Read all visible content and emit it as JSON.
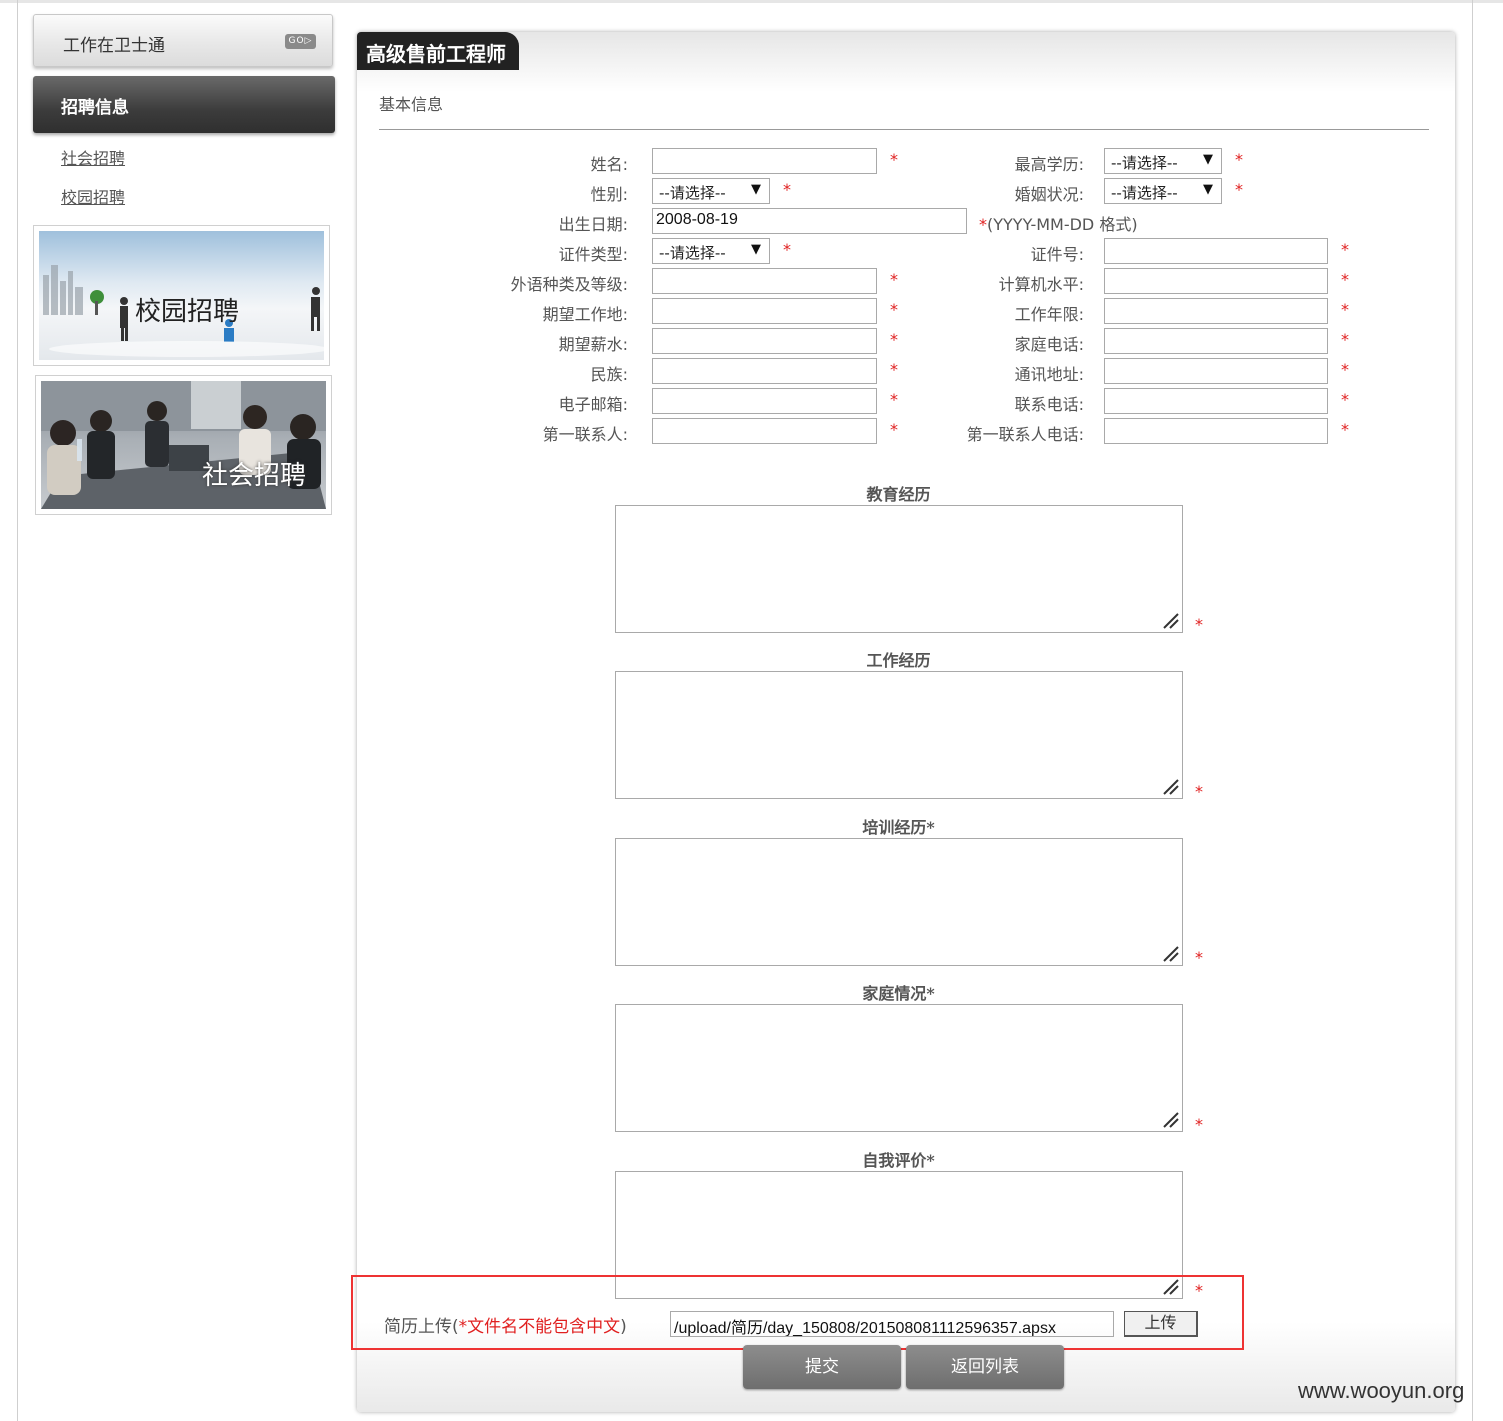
{
  "sidebar": {
    "company_box": "工作在卫士通",
    "go_badge": "GO▷",
    "section_header": "招聘信息",
    "links": [
      "社会招聘",
      "校园招聘"
    ],
    "banner_campus_text": "校园招聘",
    "banner_social_text": "社会招聘"
  },
  "job": {
    "title": "高级售前工程师",
    "section": "基本信息"
  },
  "form": {
    "required_mark": "*",
    "name_label": "姓名:",
    "gender_label": "性别:",
    "birth_label": "出生日期:",
    "birth_value": "2008-08-19",
    "birth_hint_star": "*",
    "birth_hint": "(YYYY-MM-DD 格式)",
    "idtype_label": "证件类型:",
    "lang_label": "外语种类及等级:",
    "workplace_label": "期望工作地:",
    "salary_label": "期望薪水:",
    "ethnic_label": "民族:",
    "email_label": "电子邮箱:",
    "contact_label": "第一联系人:",
    "edu_label": "最高学历:",
    "marital_label": "婚姻状况:",
    "idno_label": "证件号:",
    "computer_label": "计算机水平:",
    "years_label": "工作年限:",
    "homephone_label": "家庭电话:",
    "address_label": "通讯地址:",
    "phone_label": "联系电话:",
    "contact_phone_label": "第一联系人电话:",
    "select_placeholder": "--请选择--",
    "select_arrow": "▼"
  },
  "textareas": {
    "education": "教育经历",
    "work": "工作经历",
    "training": "培训经历*",
    "family": "家庭情况*",
    "self_eval": "自我评价*"
  },
  "upload": {
    "label_prefix": "简历上传(",
    "label_red": "*文件名不能包含中文",
    "label_suffix": ")",
    "path_value": "/upload/简历/day_150808/201508081112596357.apsx",
    "button": "上传"
  },
  "actions": {
    "submit": "提交",
    "back": "返回列表"
  },
  "watermark": "www.wooyun.org"
}
